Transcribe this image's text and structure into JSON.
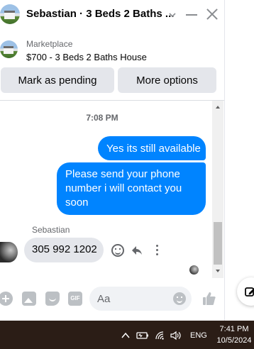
{
  "header": {
    "title": "Sebastian · 3 Beds 2 Baths ...",
    "chevron_icon": "chevron-down-icon",
    "minimize_icon": "minimize-icon",
    "close_icon": "close-icon"
  },
  "marketplace": {
    "label": "Marketplace",
    "listing_title": "$700 - 3 Beds 2 Baths House"
  },
  "actions": {
    "pending_label": "Mark as pending",
    "more_label": "More options"
  },
  "conversation": {
    "timestamp": "7:08 PM",
    "outgoing": [
      {
        "text": "Yes its still available"
      },
      {
        "text": "Please send your phone number i will contact you soon"
      }
    ],
    "incoming_sender": "Sebastian",
    "incoming_text": "305 992 1202"
  },
  "composer": {
    "placeholder": "Aa",
    "gif_label": "GIF"
  },
  "taskbar": {
    "language": "ENG",
    "time": "7:41 PM",
    "date": "10/5/2024"
  },
  "colors": {
    "accent": "#0084ff",
    "bubble_in": "#e4e6eb",
    "taskbar": "#2b1d16"
  }
}
